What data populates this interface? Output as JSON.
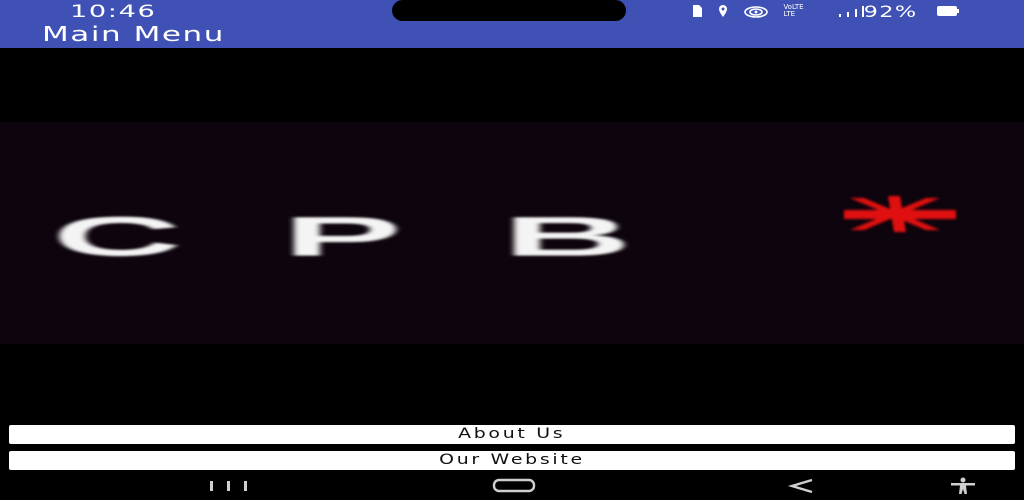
{
  "status_bar": {
    "time": "10:46",
    "network_line1": "VoLTE",
    "network_line2": "LTE",
    "battery_percent": "92%",
    "icons": [
      "sim-icon",
      "location-icon",
      "hotspot-icon",
      "signal-icon",
      "battery-icon"
    ]
  },
  "app_bar": {
    "title": "Main Menu",
    "color": "#3f51b5"
  },
  "logo": {
    "text": "CPB",
    "asterisk_color": "#e01010",
    "background": "#0d040d"
  },
  "buttons": {
    "about_label": "About Us",
    "website_label": "Our Website"
  },
  "nav_bar": {
    "icons": [
      "recent-apps-icon",
      "home-icon",
      "back-icon",
      "accessibility-icon"
    ]
  }
}
